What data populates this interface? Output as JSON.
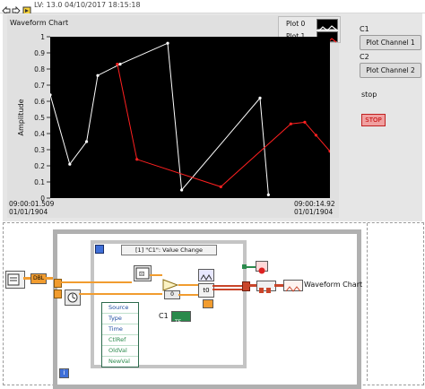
{
  "toolbar": {
    "version_text": "LV: 13.0 04/10/2017 18:15:18"
  },
  "front_panel": {
    "chart_title": "Waveform Chart",
    "legend": [
      {
        "label": "Plot 0",
        "color": "#ffffff"
      },
      {
        "label": "Plot 1",
        "color": "#ff2020"
      }
    ],
    "y_axis_label": "Amplitude",
    "x_start": {
      "time": "09:00:01.509",
      "date": "01/01/1904"
    },
    "x_end": {
      "time": "09:00:14.92",
      "date": "01/01/1904"
    },
    "controls": {
      "c1_label": "C1",
      "c1_button": "Plot Channel 1",
      "c2_label": "C2",
      "c2_button": "Plot Channel 2",
      "stop_label": "stop",
      "stop_button": "STOP"
    }
  },
  "chart_data": {
    "type": "line",
    "title": "Waveform Chart",
    "ylabel": "Amplitude",
    "xlabel": "",
    "ylim": [
      0,
      1
    ],
    "yticks": [
      0,
      0.1,
      0.2,
      0.3,
      0.4,
      0.5,
      0.6,
      0.7,
      0.8,
      0.9,
      1
    ],
    "x_range": [
      "09:00:01.509 01/01/1904",
      "09:00:14.92 01/01/1904"
    ],
    "grid": false,
    "legend_position": "top-right",
    "series": [
      {
        "name": "Plot 0",
        "color": "#ffffff",
        "points": [
          [
            0.0,
            0.64
          ],
          [
            0.07,
            0.21
          ],
          [
            0.13,
            0.35
          ],
          [
            0.17,
            0.76
          ],
          [
            0.25,
            0.83
          ],
          [
            0.42,
            0.96
          ],
          [
            0.47,
            0.05
          ],
          [
            0.75,
            0.62
          ],
          [
            0.78,
            0.02
          ]
        ]
      },
      {
        "name": "Plot 1",
        "color": "#ff2020",
        "points": [
          [
            0.24,
            0.83
          ],
          [
            0.31,
            0.24
          ],
          [
            0.61,
            0.07
          ],
          [
            0.86,
            0.46
          ],
          [
            0.91,
            0.47
          ],
          [
            0.95,
            0.39
          ],
          [
            1.0,
            0.29
          ]
        ]
      }
    ]
  },
  "block_diagram": {
    "event_case": "[1] \"C1\": Value Change",
    "node_items": [
      "Source",
      "Type",
      "Time",
      "CtlRef",
      "OldVal",
      "NewVal"
    ],
    "dbl_label": "DBL",
    "c1_terminal": "C1",
    "t0_label": "t0",
    "waveform_chart_label": "Waveform Chart",
    "zero_label": "0",
    "iteration_label": "i"
  }
}
